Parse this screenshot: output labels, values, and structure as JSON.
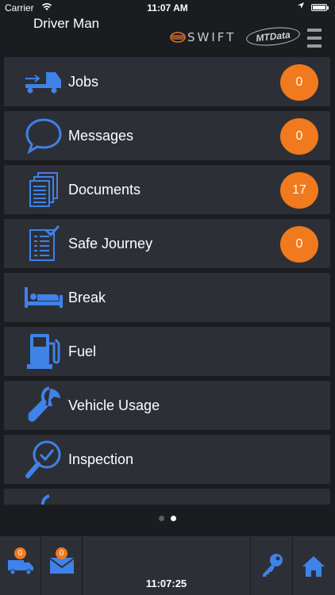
{
  "status_bar": {
    "carrier": "Carrier",
    "time": "11:07 AM"
  },
  "header": {
    "user_name": "Driver Man",
    "brand_logo": "SWIFT",
    "partner_logo": "MTData"
  },
  "tiles": [
    {
      "label": "Jobs",
      "icon": "truck-arrow-icon",
      "badge": "0"
    },
    {
      "label": "Messages",
      "icon": "chat-bubble-icon",
      "badge": "0"
    },
    {
      "label": "Documents",
      "icon": "documents-icon",
      "badge": "17"
    },
    {
      "label": "Safe Journey",
      "icon": "checklist-icon",
      "badge": "0"
    },
    {
      "label": "Break",
      "icon": "bed-icon"
    },
    {
      "label": "Fuel",
      "icon": "fuel-pump-icon"
    },
    {
      "label": "Vehicle Usage",
      "icon": "wrench-icon"
    },
    {
      "label": "Inspection",
      "icon": "magnifier-check-icon"
    }
  ],
  "pager": {
    "count": 2,
    "active_index": 1
  },
  "footer": {
    "jobs_badge": "0",
    "messages_badge": "0",
    "clock": "11:07:25"
  },
  "colors": {
    "accent": "#3f82e8",
    "badge": "#f07a1d",
    "tile": "#2d2f36",
    "background": "#1b1c20"
  }
}
